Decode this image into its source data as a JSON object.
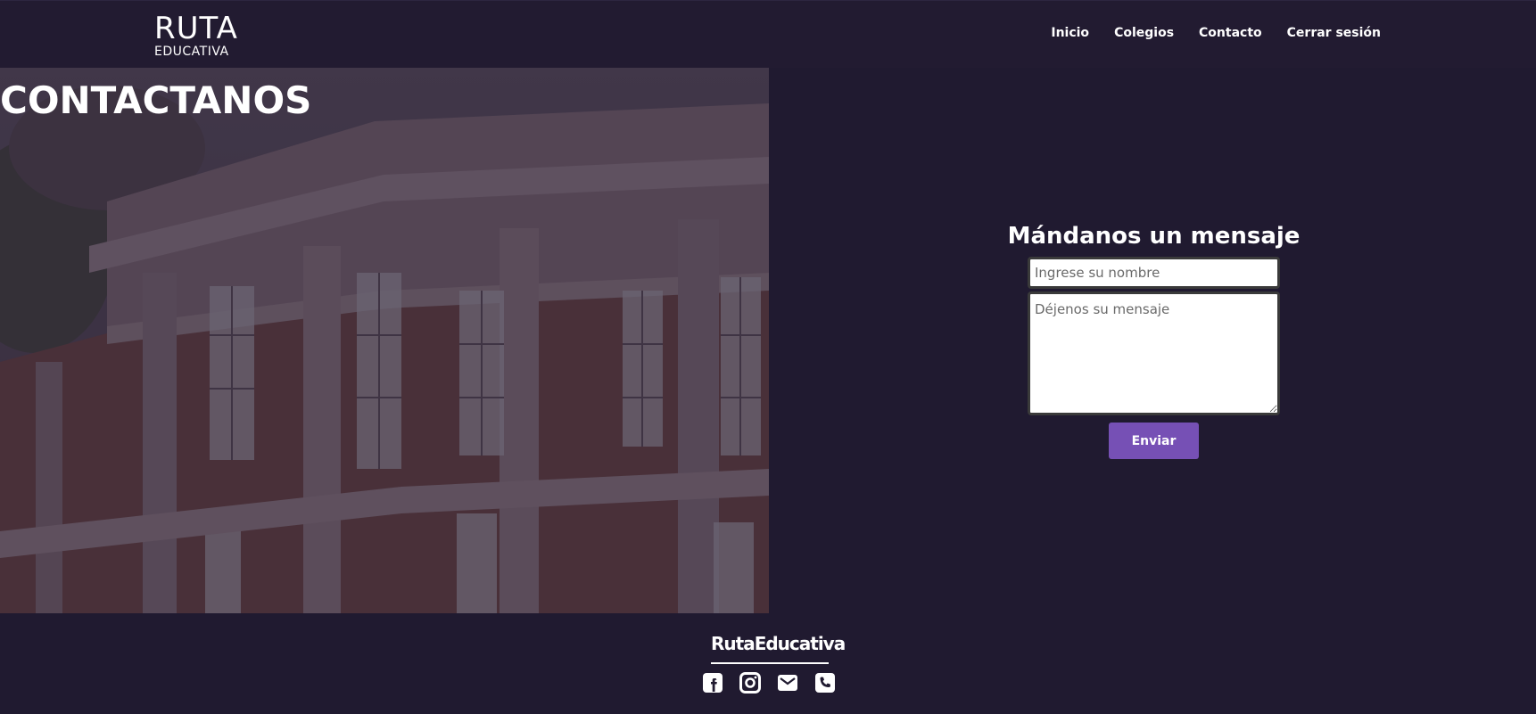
{
  "header": {
    "logo_top": "RUTA",
    "logo_bottom": "EDUCATIVA",
    "nav": [
      "Inicio",
      "Colegios",
      "Contacto",
      "Cerrar sesión"
    ]
  },
  "hero": {
    "title": "CONTACTANOS"
  },
  "form": {
    "title": "Mándanos un mensaje",
    "name_placeholder": "Ingrese su nombre",
    "message_placeholder": "Déjenos su mensaje",
    "submit_label": "Enviar"
  },
  "footer": {
    "brand": "RutaEducativa",
    "socials": [
      "facebook-icon",
      "instagram-icon",
      "email-icon",
      "phone-icon"
    ]
  },
  "colors": {
    "background": "#201a30",
    "accent": "#7650b5"
  }
}
